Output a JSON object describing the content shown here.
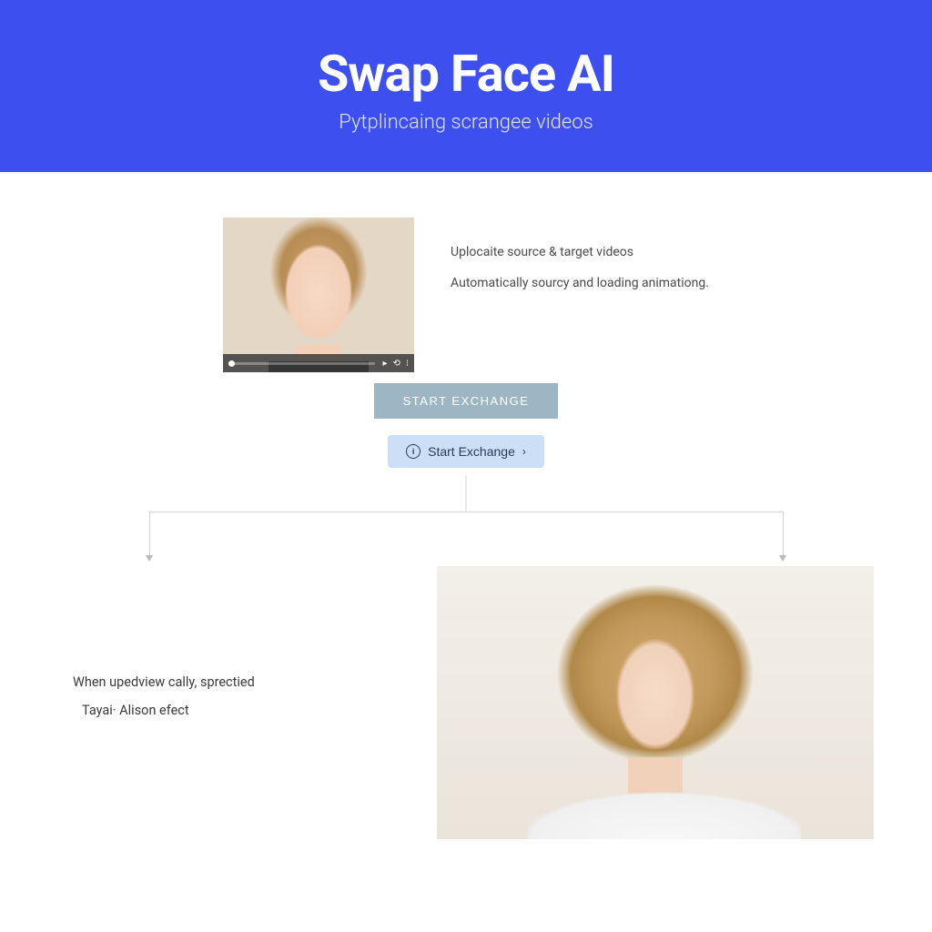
{
  "header": {
    "title": "Swap Face AI",
    "subtitle": "Pytplincaing scrangee videos"
  },
  "upload": {
    "line1": "Uplocaite source & target videos",
    "line2": "Automatically sourcy and loading animationg."
  },
  "buttons": {
    "primary": "START EXCHANGE",
    "secondary": "Start Exchange"
  },
  "result": {
    "line1": "When upedview cally, sprectied",
    "line2": "Tayai· Alison efect"
  },
  "icons": {
    "info": "i",
    "chevron_right": "›"
  }
}
